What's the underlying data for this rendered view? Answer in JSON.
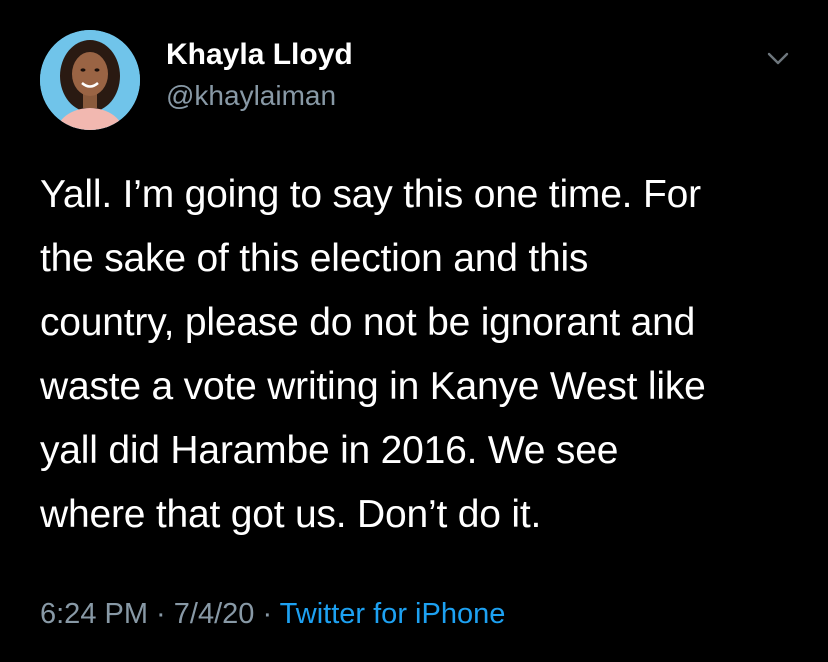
{
  "user": {
    "display_name": "Khayla Lloyd",
    "handle": "@khaylaiman"
  },
  "tweet": {
    "lines": [
      "Yall. I’m going to say this one time. For",
      "the sake of this election and this",
      "country, please do not be ignorant and",
      "waste a vote writing in Kanye West like",
      "yall did Harambe in 2016. We see",
      "where that got us. Don’t do it."
    ]
  },
  "meta": {
    "time": "6:24 PM",
    "separator_1": " · ",
    "date": "7/4/20",
    "separator_2": " · ",
    "source": "Twitter for iPhone"
  },
  "icons": {
    "menu": "chevron-down-icon"
  },
  "colors": {
    "background": "#000000",
    "secondary_text": "#8899a6",
    "link": "#1da1f2"
  }
}
